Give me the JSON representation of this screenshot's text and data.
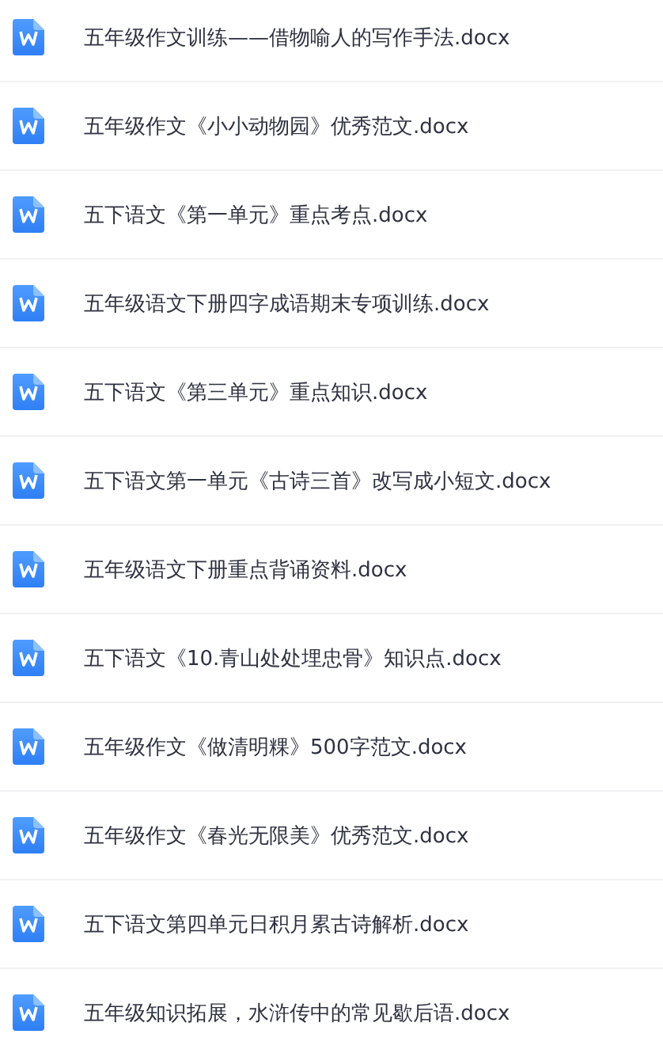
{
  "files": [
    {
      "name": "五年级作文训练——借物喻人的写作手法.docx",
      "kind": "word"
    },
    {
      "name": "五年级作文《小小动物园》优秀范文.docx",
      "kind": "word"
    },
    {
      "name": "五下语文《第一单元》重点考点.docx",
      "kind": "word"
    },
    {
      "name": "五年级语文下册四字成语期末专项训练.docx",
      "kind": "word"
    },
    {
      "name": "五下语文《第三单元》重点知识.docx",
      "kind": "word"
    },
    {
      "name": "五下语文第一单元《古诗三首》改写成小短文.docx",
      "kind": "word"
    },
    {
      "name": "五年级语文下册重点背诵资料.docx",
      "kind": "word"
    },
    {
      "name": "五下语文《10.青山处处埋忠骨》知识点.docx",
      "kind": "word"
    },
    {
      "name": "五年级作文《做清明粿》500字范文.docx",
      "kind": "word"
    },
    {
      "name": "五年级作文《春光无限美》优秀范文.docx",
      "kind": "word"
    },
    {
      "name": "五下语文第四单元日积月累古诗解析.docx",
      "kind": "word"
    },
    {
      "name": "五年级知识拓展，水浒传中的常见歇后语.docx",
      "kind": "word"
    }
  ]
}
